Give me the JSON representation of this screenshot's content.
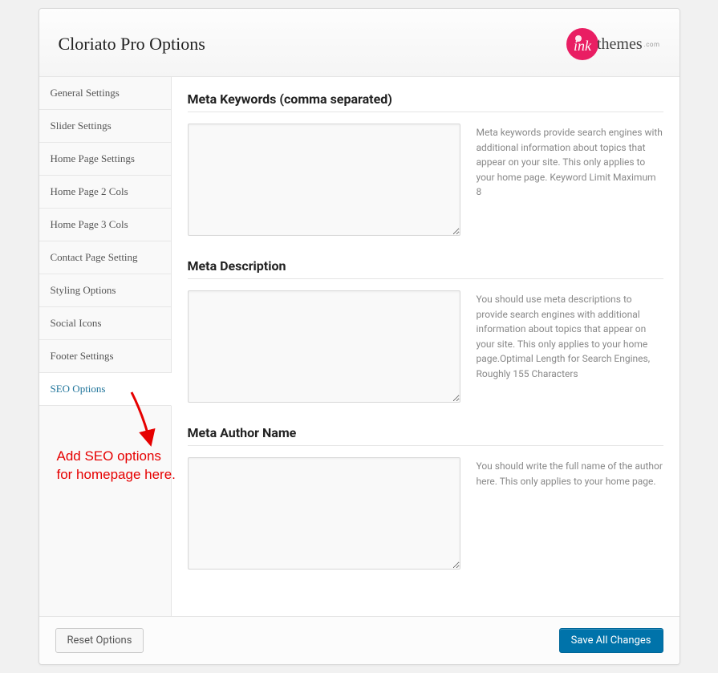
{
  "header": {
    "title": "Cloriato Pro Options",
    "logoText": "themes",
    "logoSub": ".com"
  },
  "sidebar": {
    "items": [
      "General Settings",
      "Slider Settings",
      "Home Page Settings",
      "Home Page 2 Cols",
      "Home Page 3 Cols",
      "Contact Page Setting",
      "Styling Options",
      "Social Icons",
      "Footer Settings",
      "SEO Options"
    ],
    "activeIndex": 9
  },
  "sections": [
    {
      "title": "Meta Keywords (comma separated)",
      "value": "",
      "help": "Meta keywords provide search engines with additional information about topics that appear on your site. This only applies to your home page. Keyword Limit Maximum 8"
    },
    {
      "title": "Meta Description",
      "value": "",
      "help": "You should use meta descriptions to provide search engines with additional information about topics that appear on your site. This only applies to your home page.Optimal Length for Search Engines, Roughly 155 Characters"
    },
    {
      "title": "Meta Author Name",
      "value": "",
      "help": "You should write the full name of the author here. This only applies to your home page."
    }
  ],
  "footer": {
    "reset": "Reset Options",
    "save": "Save All Changes"
  },
  "annotation": {
    "line1": "Add SEO options",
    "line2": "for homepage here."
  }
}
